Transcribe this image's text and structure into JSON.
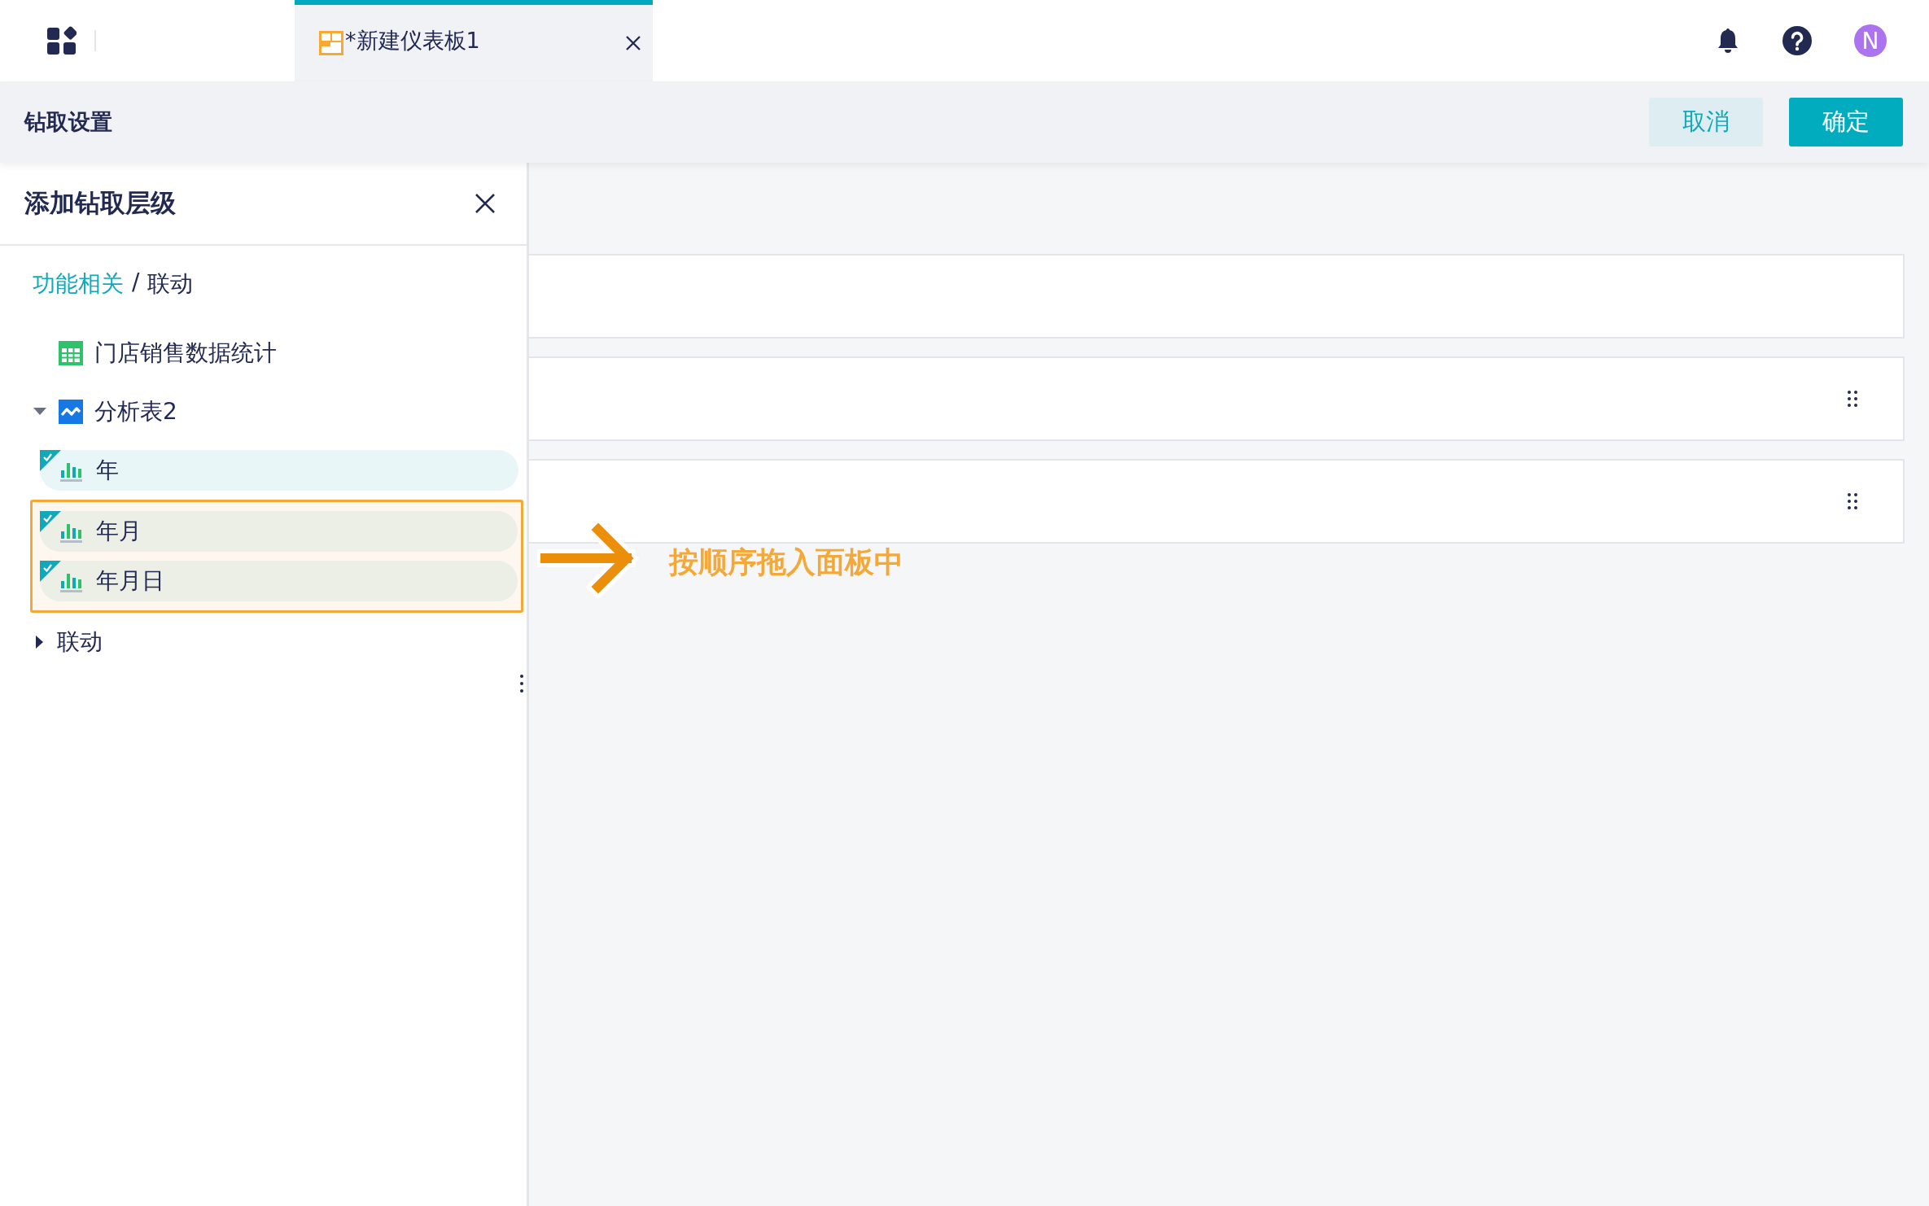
{
  "top_bar": {
    "tabs": [
      {
        "label": "*新建仪表板1",
        "selected": true
      }
    ],
    "avatar": "N"
  },
  "header": {
    "title": "钻取设置",
    "buttons": [
      {
        "label": "取消",
        "kind": "secondary"
      },
      {
        "label": "确定",
        "kind": "primary"
      }
    ]
  },
  "panel": {
    "title": "添加钻取层级",
    "breadcrumb": [
      {
        "label": "功能相关",
        "kind": "link"
      },
      {
        "label": "/",
        "kind": "separator"
      },
      {
        "label": "联动",
        "kind": "current"
      }
    ],
    "tree": [
      {
        "label": "门店销售数据统计",
        "kind": "table"
      },
      {
        "label": "分析表2",
        "kind": "analysis",
        "expanded": true,
        "children": [
          {
            "label": "年",
            "checked": true,
            "highlighted": false
          },
          {
            "label": "年月",
            "checked": true,
            "highlighted": true
          },
          {
            "label": "年月日",
            "checked": true,
            "highlighted": true
          }
        ]
      },
      {
        "label": "联动",
        "kind": "folder",
        "expanded": false
      }
    ]
  },
  "drop_slots": [
    {
      "draggable": false
    },
    {
      "draggable": true
    },
    {
      "draggable": true
    }
  ],
  "hint": "按顺序拖入面板中"
}
